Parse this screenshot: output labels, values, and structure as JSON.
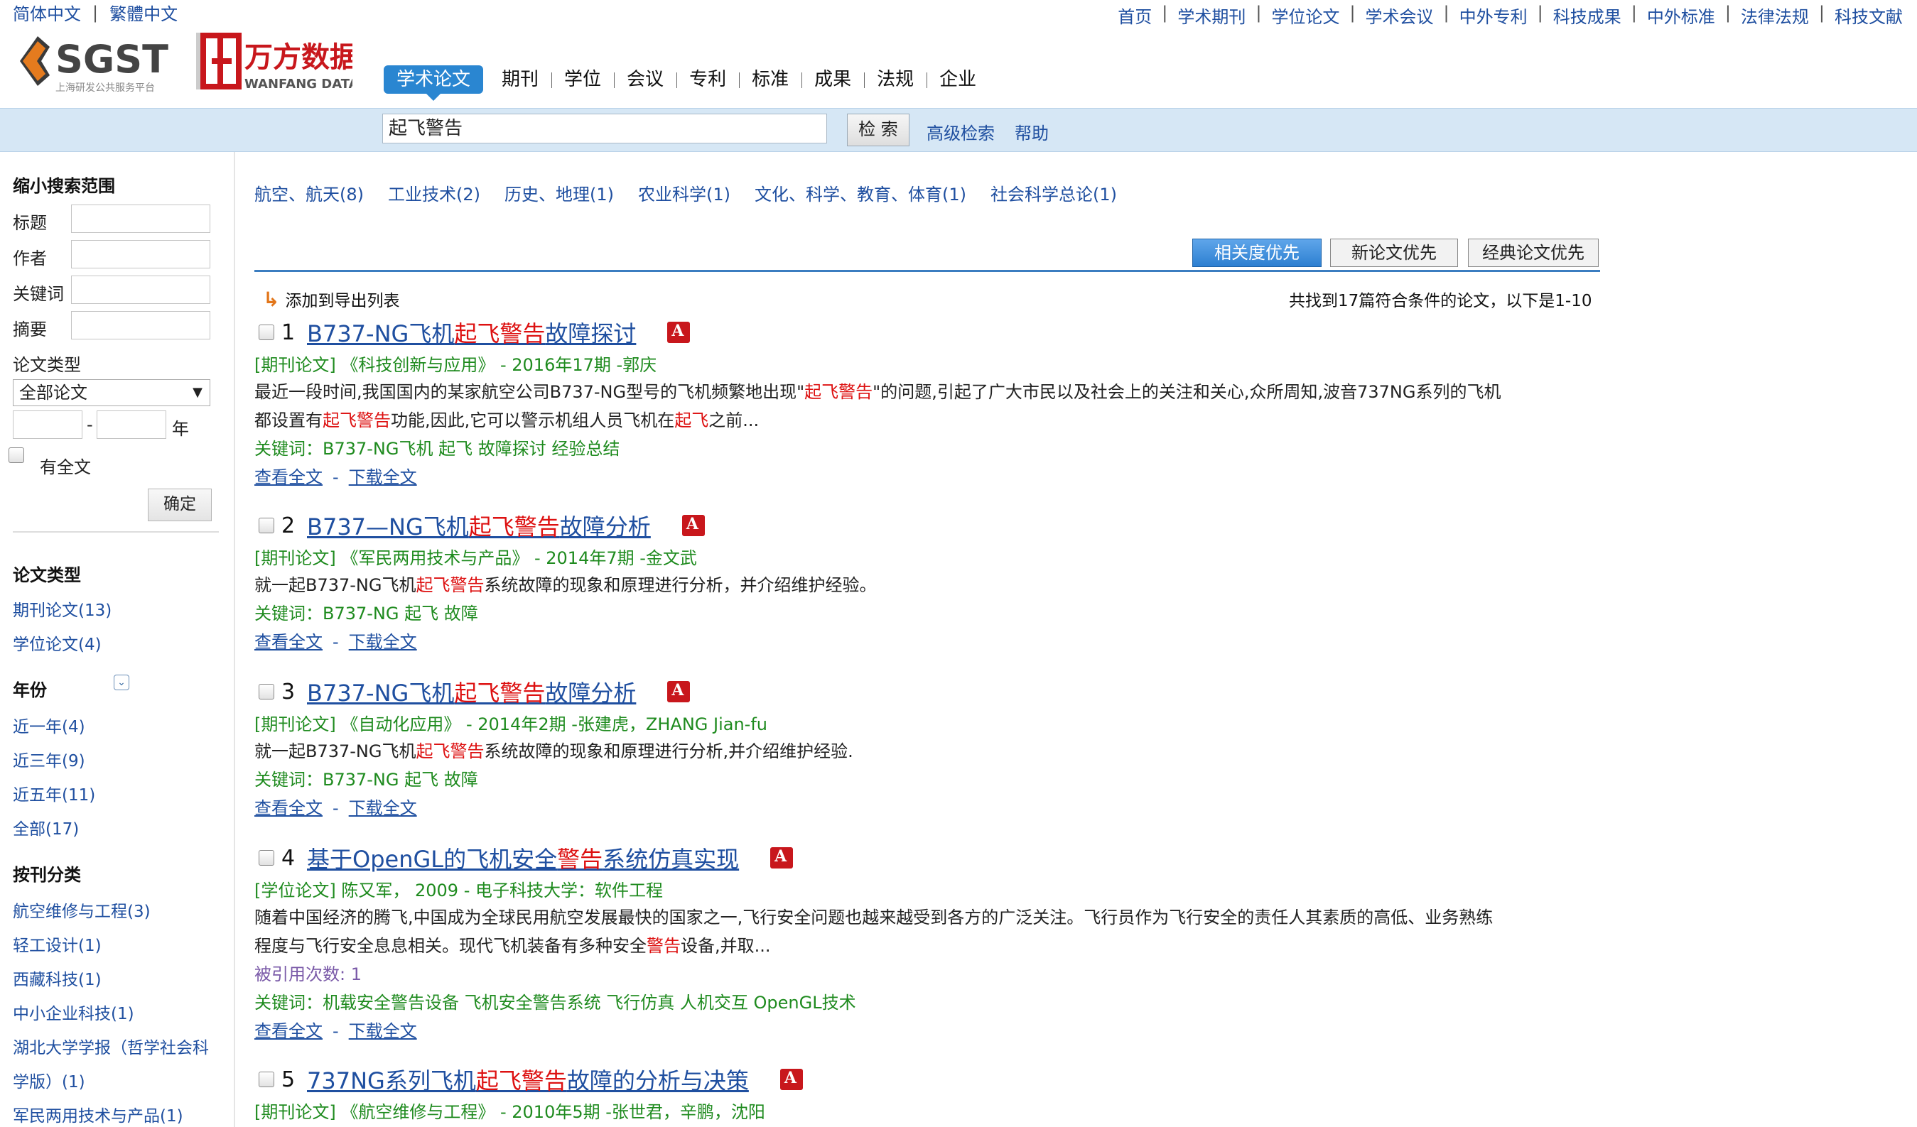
{
  "lang": {
    "simplified": "简体中文",
    "traditional": "繁體中文"
  },
  "top_links": [
    "首页",
    "学术期刊",
    "学位论文",
    "学术会议",
    "中外专利",
    "科技成果",
    "中外标准",
    "法律法规",
    "科技文献"
  ],
  "logos": {
    "sgst": "SGST",
    "sgst_sub": "上海研发公共服务平台",
    "wanfang": "万方数据",
    "wanfang_sub": "WANFANG DATA"
  },
  "main_tabs": [
    "学术论文",
    "期刊",
    "学位",
    "会议",
    "专利",
    "标准",
    "成果",
    "法规",
    "企业"
  ],
  "search": {
    "value": "起飞警告",
    "button": "检 索",
    "advanced": "高级检索",
    "help": "帮助"
  },
  "sidebar": {
    "narrow_title": "缩小搜索范围",
    "fields": [
      "标题",
      "作者",
      "关键词",
      "摘要"
    ],
    "type_label": "论文类型",
    "type_selected": "全部论文",
    "year_dash": "-",
    "year_suffix": "年",
    "fulltext_label": "有全文",
    "ok_button": "确定",
    "paper_type_title": "论文类型",
    "paper_types": [
      "期刊论文(13)",
      "学位论文(4)"
    ],
    "year_title": "年份",
    "years": [
      "近一年(4)",
      "近三年(9)",
      "近五年(11)",
      "全部(17)"
    ],
    "journal_cat_title": "按刊分类",
    "journal_cats": [
      "航空维修与工程(3)",
      "轻工设计(1)",
      "西藏科技(1)",
      "中小企业科技(1)",
      "湖北大学学报（哲学社会科",
      "学版）(1)",
      "军民两用技术与产品(1)"
    ]
  },
  "categories": [
    "航空、航天(8)",
    "工业技术(2)",
    "历史、地理(1)",
    "农业科学(1)",
    "文化、科学、教育、体育(1)",
    "社会科学总论(1)"
  ],
  "sort": {
    "relevance": "相关度优先",
    "newest": "新论文优先",
    "classic": "经典论文优先"
  },
  "export_label": "添加到导出列表",
  "found_text": "共找到17篇符合条件的论文，以下是1-10",
  "results": [
    {
      "num": "1",
      "title_pre": "B737-NG飞机",
      "title_hl": "起飞警告",
      "title_post": "故障探讨",
      "meta": "[期刊论文]  《科技创新与应用》  - 2016年17期 -郭庆",
      "abs1_pre": "最近一段时间,我国国内的某家航空公司B737-NG型号的飞机频繁地出现\"",
      "abs1_hl": "起飞警告",
      "abs1_post": "\"的问题,引起了广大市民以及社会上的关注和关心,众所周知,波音737NG系列的飞机",
      "abs2_pre": "都设置有",
      "abs2_hl": "起飞警告",
      "abs2_mid": "功能,因此,它可以警示机组人员飞机在",
      "abs2_hl2": "起飞",
      "abs2_post": "之前...",
      "keywords": "关键词：B737-NG飞机 起飞 故障探讨 经验总结",
      "view": "查看全文",
      "dash": "-",
      "download": "下载全文"
    },
    {
      "num": "2",
      "title_pre": "B737—NG飞机",
      "title_hl": "起飞警告",
      "title_post": "故障分析",
      "meta": "[期刊论文]  《军民两用技术与产品》  - 2014年7期 -金文武",
      "abs_pre": "就一起B737-NG飞机",
      "abs_hl": "起飞警告",
      "abs_post": "系统故障的现象和原理进行分析，并介绍维护经验。",
      "keywords": "关键词：B737-NG 起飞 故障",
      "view": "查看全文",
      "dash": "-",
      "download": "下载全文"
    },
    {
      "num": "3",
      "title_pre": "B737-NG飞机",
      "title_hl": "起飞警告",
      "title_post": "故障分析",
      "meta": "[期刊论文]  《自动化应用》  - 2014年2期 -张建虎，ZHANG Jian-fu",
      "abs_pre": "就一起B737-NG飞机",
      "abs_hl": "起飞警告",
      "abs_post": "系统故障的现象和原理进行分析,并介绍维护经验.",
      "keywords": "关键词：B737-NG 起飞 故障",
      "view": "查看全文",
      "dash": "-",
      "download": "下载全文"
    },
    {
      "num": "4",
      "title_pre": "基于OpenGL的飞机安全",
      "title_hl": "警告",
      "title_post": "系统仿真实现",
      "meta": "[学位论文]  陈又军，  2009 - 电子科技大学：软件工程",
      "abs1": "随着中国经济的腾飞,中国成为全球民用航空发展最快的国家之一,飞行安全问题也越来越受到各方的广泛关注。飞行员作为飞行安全的责任人其素质的高低、业务熟练",
      "abs2_pre": "程度与飞行安全息息相关。现代飞机装备有多种安全",
      "abs2_hl": "警告",
      "abs2_post": "设备,并取...",
      "cited": "被引用次数: 1",
      "keywords": "关键词：机载安全警告设备 飞机安全警告系统 飞行仿真 人机交互 OpenGL技术",
      "view": "查看全文",
      "dash": "-",
      "download": "下载全文"
    },
    {
      "num": "5",
      "title_pre": "737NG系列飞机",
      "title_hl": "起飞警告",
      "title_post": "故障的分析与决策",
      "meta": "[期刊论文]  《航空维修与工程》  - 2010年5期 -张世君，辛鹏，沈阳"
    }
  ],
  "colors": {
    "link": "#1f4fa0",
    "highlight": "#d11111",
    "meta_green": "#1f8b1f",
    "search_band": "#d6e7f5",
    "active_tab": "#2a86d1"
  }
}
